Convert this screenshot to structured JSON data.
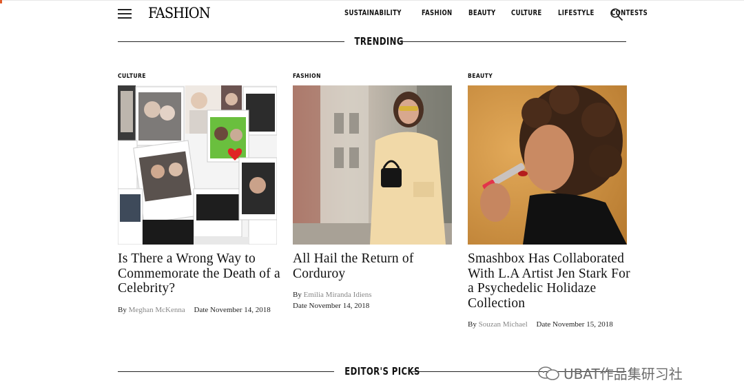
{
  "header": {
    "logo": "FASHION",
    "nav": [
      "SUSTAINABILITY",
      "FASHION",
      "BEAUTY",
      "CULTURE",
      "LIFESTYLE",
      "CONTESTS"
    ]
  },
  "trending": {
    "title": "TRENDING",
    "cards": [
      {
        "kicker": "CULTURE",
        "headline": "Is There a Wrong Way to Commemorate the Death of a Celebrity?",
        "by": "By",
        "author": "Meghan McKenna",
        "date": "Date November 14, 2018"
      },
      {
        "kicker": "FASHION",
        "headline": "All Hail the Return of Corduroy",
        "by": "By",
        "author": "Emilia Miranda Idiens",
        "date": "Date November 14, 2018"
      },
      {
        "kicker": "BEAUTY",
        "headline": "Smashbox Has Collaborated With L.A Artist Jen Stark For a Psychedelic Holidaze Collection",
        "by": "By",
        "author": "Souzan Michael",
        "date": "Date November 15, 2018"
      }
    ]
  },
  "editors_picks": {
    "title": "EDITOR'S PICKS"
  },
  "watermark": "UBAT作品集研习社",
  "colors": {
    "accent": "#e05a2a",
    "text": "#111111",
    "muted": "#888888"
  }
}
